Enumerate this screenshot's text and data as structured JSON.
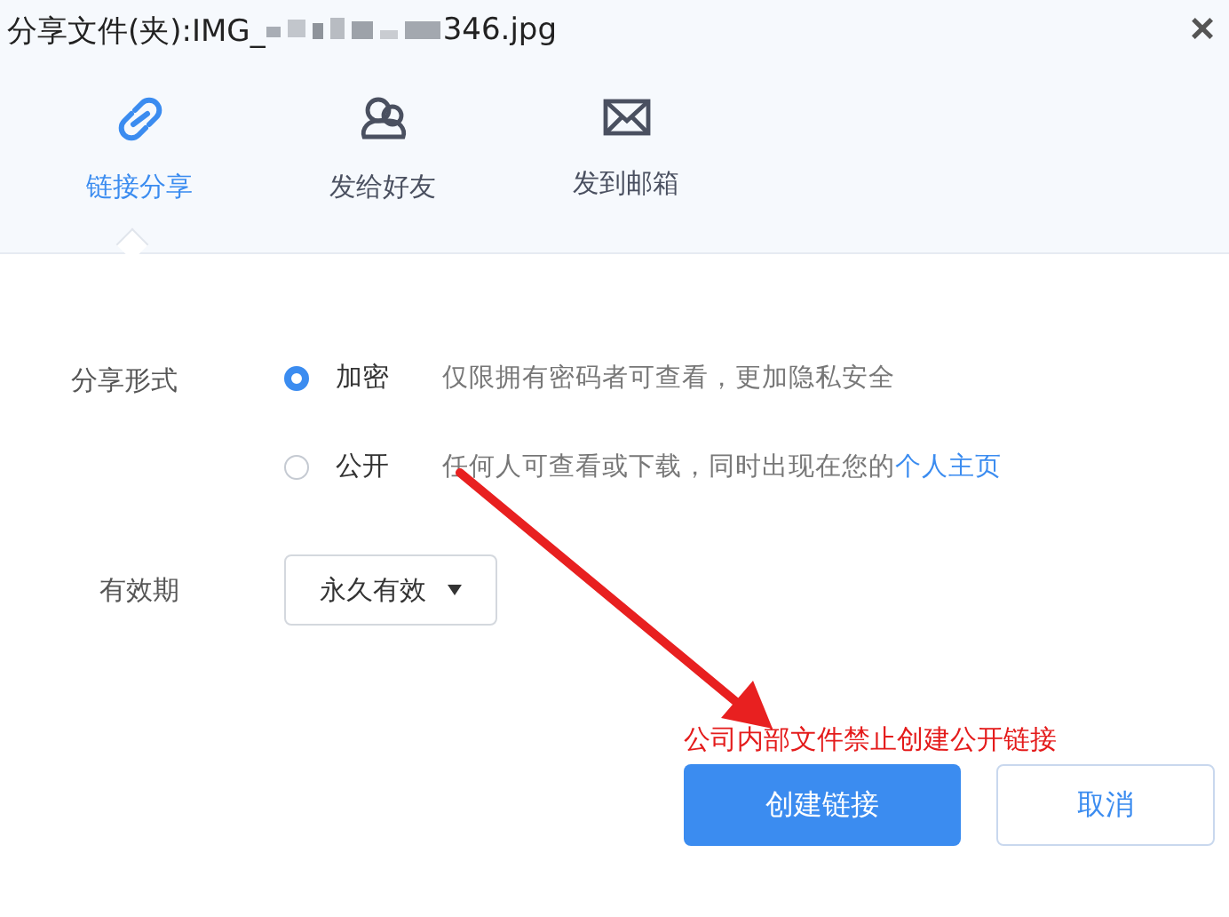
{
  "window": {
    "title_prefix": "分享文件(夹):IMG_",
    "title_suffix": "346.jpg",
    "close": "×"
  },
  "tabs": [
    {
      "label": "链接分享",
      "kind": "link",
      "selected": true
    },
    {
      "label": "发给好友",
      "kind": "friends",
      "selected": false
    },
    {
      "label": "发到邮箱",
      "kind": "mail",
      "selected": false
    }
  ],
  "share_form": {
    "label": "分享形式",
    "options": [
      {
        "label": "加密",
        "description": "仅限拥有密码者可查看，更加隐私安全",
        "selected": true
      },
      {
        "label": "公开",
        "description": "任何人可查看或下载，同时出现在您的",
        "link": "个人主页",
        "selected": false
      }
    ]
  },
  "validity": {
    "label": "有效期",
    "value": "永久有效"
  },
  "notice": "公司内部文件禁止创建公开链接",
  "buttons": [
    {
      "label": "创建链接",
      "kind": "primary"
    },
    {
      "label": "取消",
      "kind": "secondary"
    }
  ]
}
